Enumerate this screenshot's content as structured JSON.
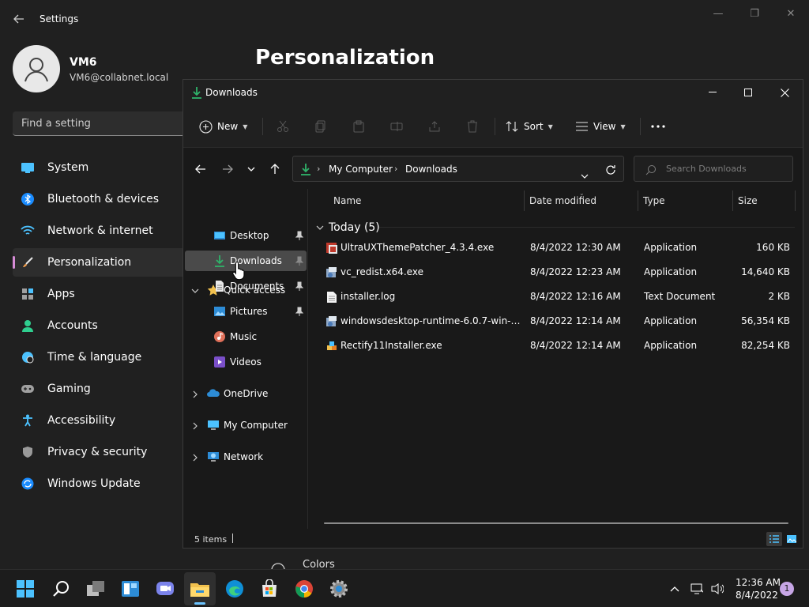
{
  "settings": {
    "title": "Settings",
    "user": {
      "name": "VM6",
      "email": "VM6@collabnet.local"
    },
    "search": {
      "placeholder": "Find a setting"
    },
    "nav": [
      {
        "label": "System",
        "icon": "system-icon"
      },
      {
        "label": "Bluetooth & devices",
        "icon": "bluetooth-icon"
      },
      {
        "label": "Network & internet",
        "icon": "wifi-icon"
      },
      {
        "label": "Personalization",
        "icon": "brush-icon",
        "active": true
      },
      {
        "label": "Apps",
        "icon": "apps-icon"
      },
      {
        "label": "Accounts",
        "icon": "person-icon"
      },
      {
        "label": "Time & language",
        "icon": "clock-globe-icon"
      },
      {
        "label": "Gaming",
        "icon": "gamepad-icon"
      },
      {
        "label": "Accessibility",
        "icon": "accessibility-icon"
      },
      {
        "label": "Privacy & security",
        "icon": "shield-icon"
      },
      {
        "label": "Windows Update",
        "icon": "update-icon"
      }
    ],
    "page_title": "Personalization",
    "colors_label": "Colors"
  },
  "explorer": {
    "title": "Downloads",
    "toolbar": {
      "new_label": "New",
      "sort_label": "Sort",
      "view_label": "View"
    },
    "breadcrumb": [
      "My Computer",
      "Downloads"
    ],
    "search": {
      "placeholder": "Search Downloads"
    },
    "navpane": {
      "quick_access": "Quick access",
      "pinned": [
        {
          "label": "Desktop",
          "pinned": true
        },
        {
          "label": "Downloads",
          "pinned": true,
          "selected": true
        },
        {
          "label": "Documents",
          "pinned": true
        },
        {
          "label": "Pictures",
          "pinned": true
        },
        {
          "label": "Music",
          "pinned": false
        },
        {
          "label": "Videos",
          "pinned": false
        }
      ],
      "roots": [
        "OneDrive",
        "My Computer",
        "Network"
      ]
    },
    "columns": {
      "name": "Name",
      "date": "Date modified",
      "type": "Type",
      "size": "Size"
    },
    "group_label": "Today (5)",
    "files": [
      {
        "name": "UltraUXThemePatcher_4.3.4.exe",
        "date": "8/4/2022 12:30 AM",
        "type": "Application",
        "size": "160 KB",
        "icon": "installer-red-icon"
      },
      {
        "name": "vc_redist.x64.exe",
        "date": "8/4/2022 12:23 AM",
        "type": "Application",
        "size": "14,640 KB",
        "icon": "setup-icon"
      },
      {
        "name": "installer.log",
        "date": "8/4/2022 12:16 AM",
        "type": "Text Document",
        "size": "2 KB",
        "icon": "text-file-icon"
      },
      {
        "name": "windowsdesktop-runtime-6.0.7-win-x64....",
        "date": "8/4/2022 12:14 AM",
        "type": "Application",
        "size": "56,354 KB",
        "icon": "setup-icon"
      },
      {
        "name": "Rectify11Installer.exe",
        "date": "8/4/2022 12:14 AM",
        "type": "Application",
        "size": "82,254 KB",
        "icon": "puzzle-app-icon"
      }
    ],
    "status": {
      "count": "5 items"
    }
  },
  "taskbar": {
    "time": "12:36 AM",
    "date": "8/4/2022",
    "notifications": "1"
  },
  "colors": {
    "accent_pink": "#d68cd6",
    "download_green": "#2fb36a",
    "folder_yellow": "#f2c14e",
    "taskbar_accent": "#6cc4ff"
  }
}
